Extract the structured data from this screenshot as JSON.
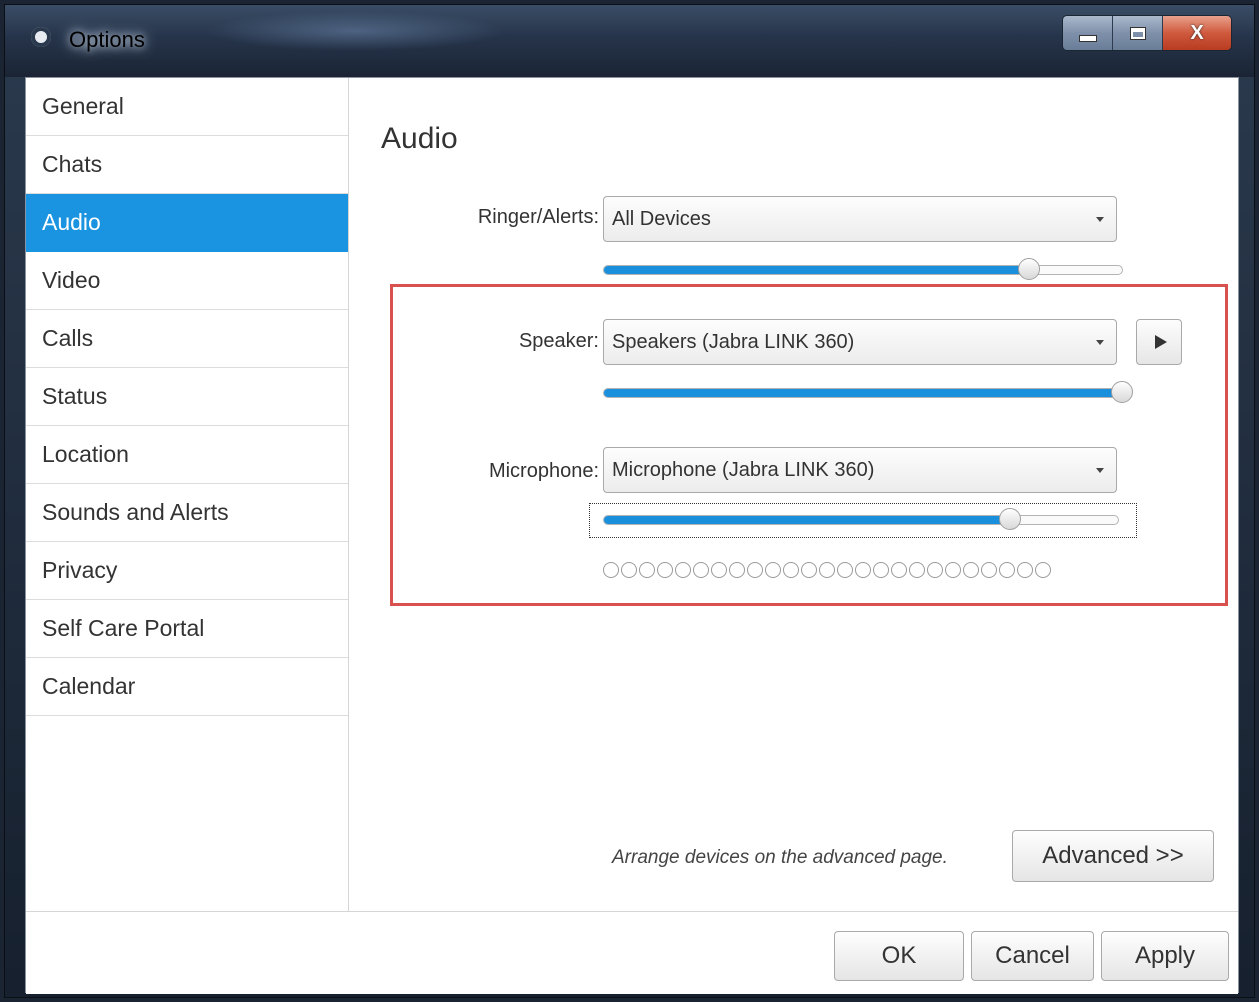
{
  "window": {
    "title": "Options",
    "controls": {
      "minimize_icon": "minimize-icon",
      "maximize_icon": "maximize-icon",
      "close_label": "X"
    }
  },
  "sidebar": {
    "items": [
      {
        "label": "General",
        "active": false
      },
      {
        "label": "Chats",
        "active": false
      },
      {
        "label": "Audio",
        "active": true
      },
      {
        "label": "Video",
        "active": false
      },
      {
        "label": "Calls",
        "active": false
      },
      {
        "label": "Status",
        "active": false
      },
      {
        "label": "Location",
        "active": false
      },
      {
        "label": "Sounds and Alerts",
        "active": false
      },
      {
        "label": "Privacy",
        "active": false
      },
      {
        "label": "Self Care Portal",
        "active": false
      },
      {
        "label": "Calendar",
        "active": false
      }
    ]
  },
  "audio": {
    "title": "Audio",
    "ringer": {
      "label": "Ringer/Alerts:",
      "value": "All Devices",
      "volume": 0.82
    },
    "speaker": {
      "label": "Speaker:",
      "value": "Speakers (Jabra LINK 360)",
      "volume": 1.0,
      "play_icon": "play-icon"
    },
    "microphone": {
      "label": "Microphone:",
      "value": "Microphone (Jabra LINK 360)",
      "volume": 0.79,
      "level_dots": 25
    },
    "advanced_note": "Arrange devices on the advanced page.",
    "advanced_button": "Advanced >>"
  },
  "footer": {
    "ok": "OK",
    "cancel": "Cancel",
    "apply": "Apply"
  },
  "colors": {
    "accent": "#1a93e0",
    "highlight": "#d9514f"
  }
}
